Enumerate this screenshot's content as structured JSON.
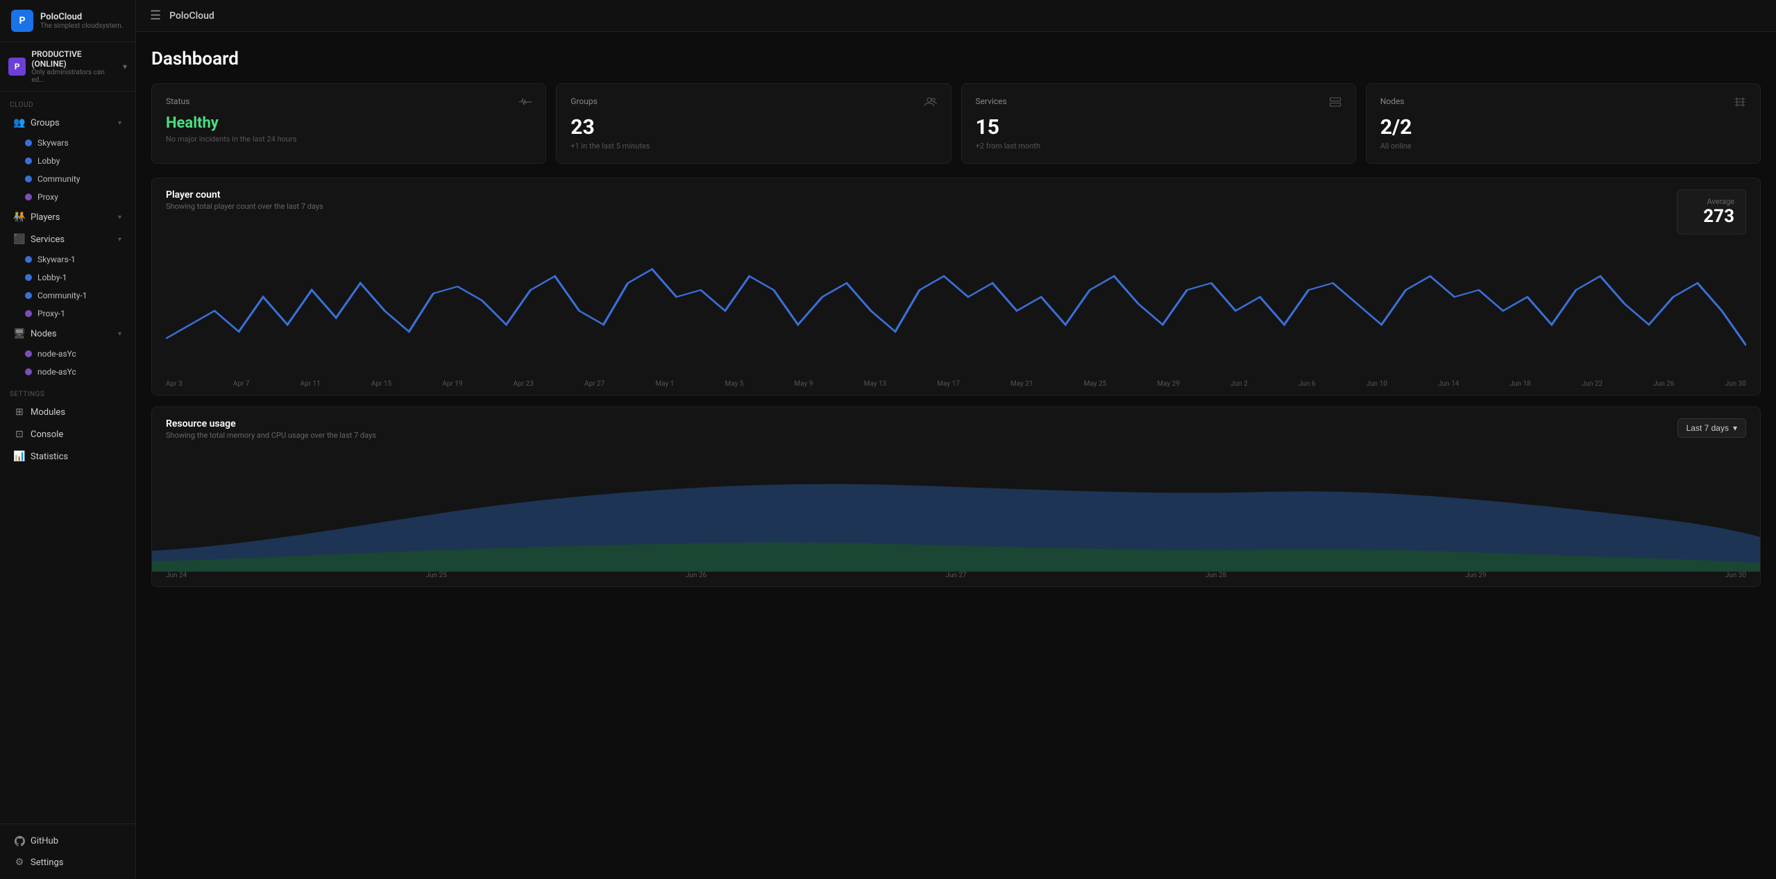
{
  "app": {
    "name": "PoloCloud",
    "tagline": "The simplest cloudsystem.",
    "topbar_title": "PoloCloud"
  },
  "workspace": {
    "initial": "P",
    "name": "PRODUCTIVE (ONLINE)",
    "sub": "Only administrators can ed..."
  },
  "sidebar": {
    "cloud_label": "Cloud",
    "settings_label": "Settings",
    "groups_label": "Groups",
    "groups_items": [
      {
        "name": "Skywars",
        "color": "blue"
      },
      {
        "name": "Lobby",
        "color": "blue"
      },
      {
        "name": "Community",
        "color": "blue"
      },
      {
        "name": "Proxy",
        "color": "purple"
      }
    ],
    "players_label": "Players",
    "services_label": "Services",
    "services_items": [
      {
        "name": "Skywars-1",
        "color": "blue"
      },
      {
        "name": "Lobby-1",
        "color": "blue"
      },
      {
        "name": "Community-1",
        "color": "blue"
      },
      {
        "name": "Proxy-1",
        "color": "purple"
      }
    ],
    "nodes_label": "Nodes",
    "nodes_items": [
      {
        "name": "node-asYc",
        "color": "purple"
      },
      {
        "name": "node-asYc",
        "color": "purple"
      }
    ],
    "modules_label": "Modules",
    "console_label": "Console",
    "statistics_label": "Statistics",
    "github_label": "GitHub",
    "settings_footer_label": "Settings"
  },
  "dashboard": {
    "title": "Dashboard",
    "stats": [
      {
        "label": "Status",
        "value": "Healthy",
        "sub": "No major incidents in the last 24 hours",
        "icon": "pulse"
      },
      {
        "label": "Groups",
        "value": "23",
        "sub": "+1 in the last 5 minutes",
        "icon": "groups"
      },
      {
        "label": "Services",
        "value": "15",
        "sub": "+2 from last month",
        "icon": "services"
      },
      {
        "label": "Nodes",
        "value": "2/2",
        "sub": "All online",
        "icon": "nodes"
      }
    ],
    "player_count": {
      "title": "Player count",
      "sub": "Showing total player count over the last 7 days",
      "average_label": "Average",
      "average_value": "273",
      "x_labels": [
        "Apr 3",
        "Apr 7",
        "Apr 11",
        "Apr 15",
        "Apr 19",
        "Apr 23",
        "Apr 27",
        "May 1",
        "May 5",
        "May 9",
        "May 13",
        "May 17",
        "May 21",
        "May 25",
        "May 29",
        "Jun 2",
        "Jun 6",
        "Jun 10",
        "Jun 14",
        "Jun 18",
        "Jun 22",
        "Jun 26",
        "Jun 30"
      ]
    },
    "resource_usage": {
      "title": "Resource usage",
      "sub": "Showing the total memory and CPU usage over the last 7 days",
      "dropdown_label": "Last 7 days",
      "x_labels": [
        "Jun 24",
        "Jun 25",
        "Jun 26",
        "Jun 27",
        "Jun 28",
        "Jun 29",
        "Jun 30"
      ]
    }
  }
}
